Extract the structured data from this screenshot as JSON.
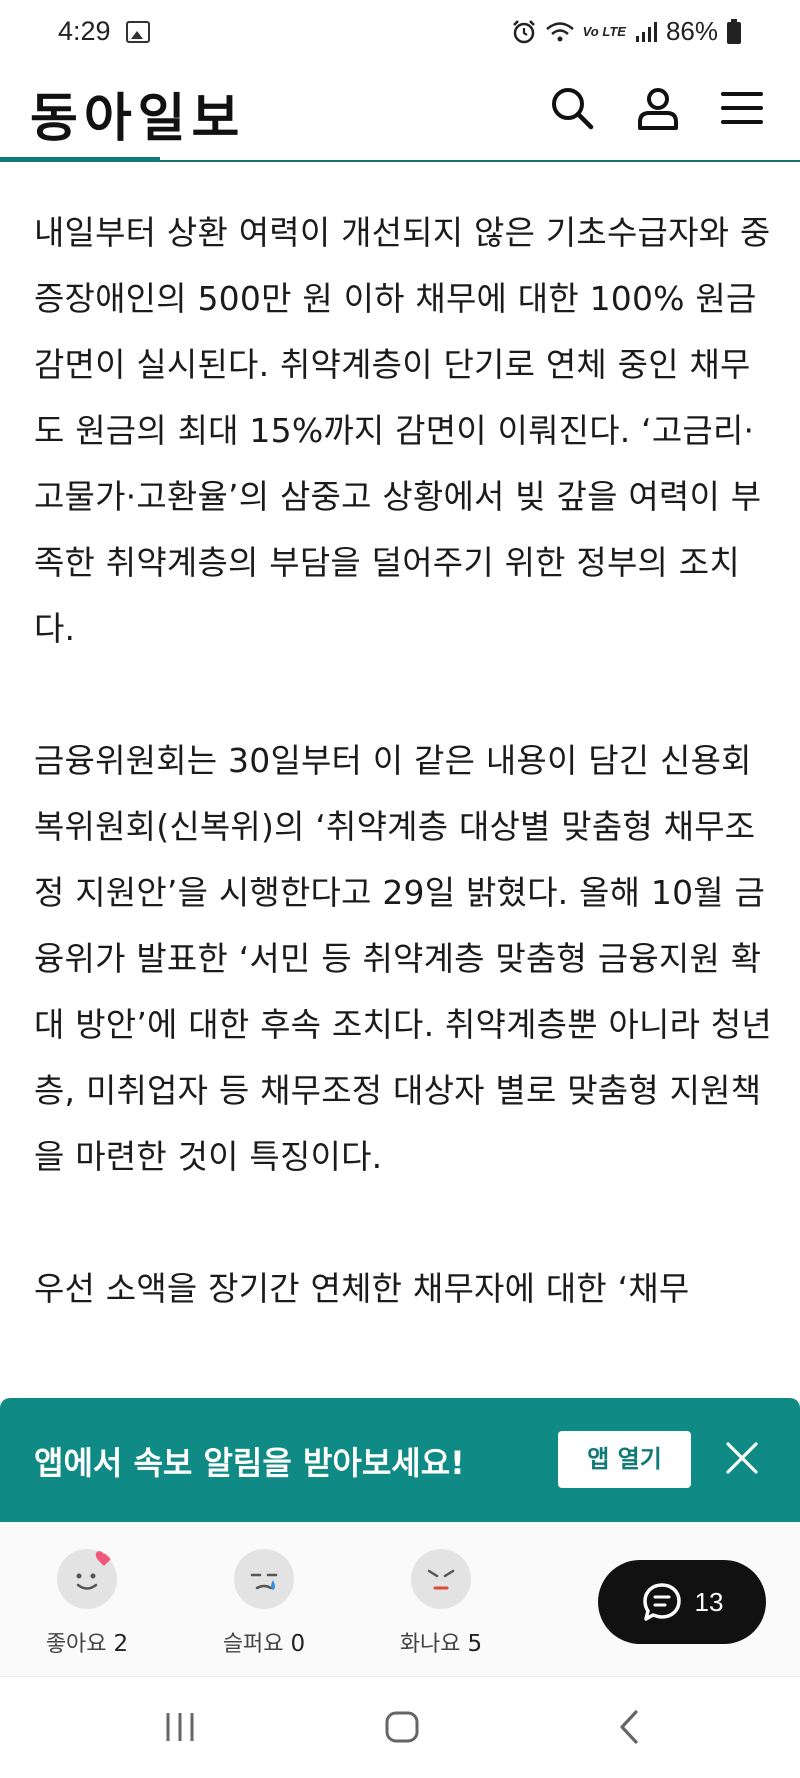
{
  "status_bar": {
    "time": "4:29",
    "network_label": "Vo LTE",
    "battery_percent": "86%",
    "icons": [
      "gallery-icon",
      "alarm-icon",
      "wifi-icon",
      "signal-icon",
      "battery-icon"
    ]
  },
  "header": {
    "logo": "동아일보",
    "icons": [
      "search-icon",
      "user-icon",
      "menu-icon"
    ],
    "accent_color": "#127a7e"
  },
  "article": {
    "paragraphs": [
      "내일부터 상환 여력이 개선되지 않은 기초수급자와 중증장애인의 500만 원 이하 채무에 대한 100% 원금 감면이 실시된다. 취약계층이 단기로 연체 중인 채무도 원금의 최대 15%까지 감면이 이뤄진다. ‘고금리·고물가·고환율’의 삼중고 상황에서 빚 갚을 여력이 부족한 취약계층의 부담을 덜어주기 위한 정부의 조치다.",
      "금융위원회는 30일부터 이 같은 내용이 담긴 신용회복위원회(신복위)의 ‘취약계층 대상별 맞춤형 채무조정 지원안’을 시행한다고 29일 밝혔다. 올해 10월 금융위가 발표한 ‘서민 등 취약계층 맞춤형 금융지원 확대 방안’에 대한 후속 조치다. 취약계층뿐 아니라 청년층, 미취업자 등 채무조정 대상자 별로 맞춤형 지원책을 마련한 것이 특징이다.",
      "우선 소액을 장기간 연체한 채무자에 대한 ‘채무"
    ]
  },
  "app_banner": {
    "message": "앱에서 속보 알림을 받아보세요!",
    "open_button": "앱 열기",
    "background_color": "#0f8a85"
  },
  "reactions": {
    "items": [
      {
        "label": "좋아요",
        "count": "2",
        "icon": "like-face-icon"
      },
      {
        "label": "슬퍼요",
        "count": "0",
        "icon": "sad-face-icon"
      },
      {
        "label": "화나요",
        "count": "5",
        "icon": "angry-face-icon"
      }
    ],
    "comment_count": "13"
  },
  "navbar": {
    "icons": [
      "recent-apps-icon",
      "home-icon",
      "back-icon"
    ]
  }
}
